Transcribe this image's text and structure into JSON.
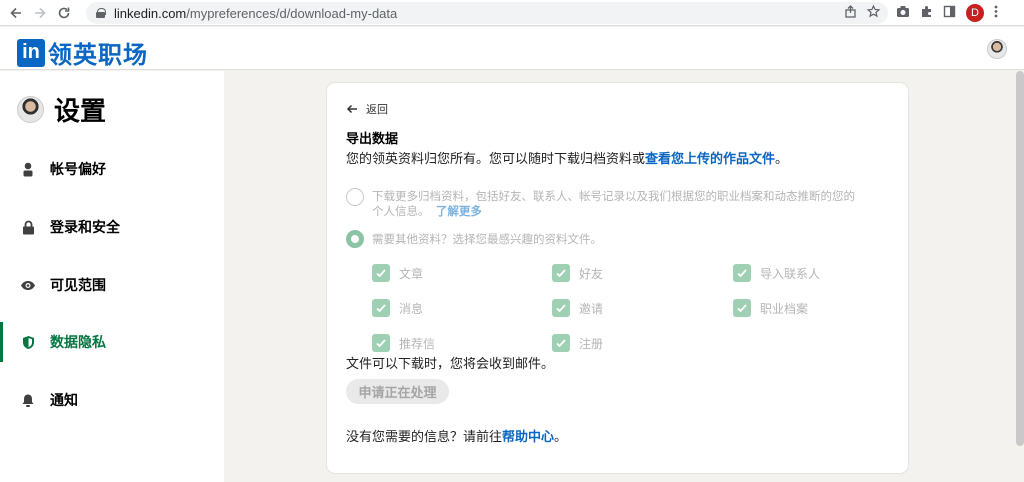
{
  "browser": {
    "url_host": "linkedin.com",
    "url_path": "/mypreferences/d/download-my-data",
    "profile_initial": "D"
  },
  "header": {
    "logo_in": "in",
    "logo_text": "领英职场"
  },
  "sidebar": {
    "title": "设置",
    "items": [
      {
        "label": "帐号偏好",
        "icon": "person-icon"
      },
      {
        "label": "登录和安全",
        "icon": "lock-icon"
      },
      {
        "label": "可见范围",
        "icon": "eye-icon"
      },
      {
        "label": "数据隐私",
        "icon": "shield-icon",
        "active": true
      },
      {
        "label": "通知",
        "icon": "bell-icon"
      }
    ]
  },
  "main": {
    "back_label": "返回",
    "heading": "导出数据",
    "description": "您的领英资料归您所有。您可以随时下载归档资料或",
    "description_link": "查看您上传的作品文件",
    "description_end": "。",
    "option1_text": "下载更多归档资料，包括好友、联系人、帐号记录以及我们根据您的职业档案和动态推断的您的",
    "option1_text2": "个人信息。",
    "option1_link": "了解更多",
    "option2_text": "需要其他资料？选择您最感兴趣的资料文件。",
    "checkboxes": [
      "文章",
      "好友",
      "导入联系人",
      "消息",
      "邀请",
      "职业档案",
      "推荐信",
      "注册"
    ],
    "notify_text": "文件可以下载时，您将会收到邮件。",
    "process_button": "申请正在处理",
    "help_text": "没有您需要的信息？请前往",
    "help_link": "帮助中心",
    "help_end": "。"
  },
  "colors": {
    "brand": "#0a66c2",
    "active_green": "#057642",
    "checkbox_green": "#9fd0b4"
  }
}
